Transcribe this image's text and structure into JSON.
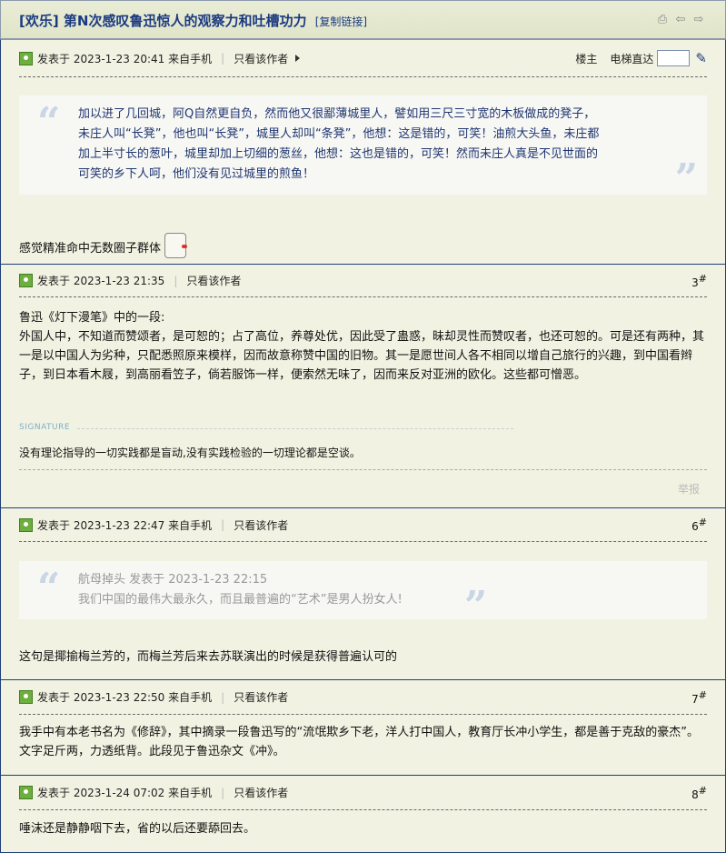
{
  "header": {
    "title": "[欢乐] 第N次感叹鲁迅惊人的观察力和吐槽功力",
    "copy_link": "[复制链接]",
    "icons": [
      "print-icon",
      "prev-icon",
      "next-icon"
    ]
  },
  "posts": [
    {
      "meta": "发表于 2023-1-23 20:41 来自手机",
      "only_author": "只看该作者",
      "floor_label": "楼主",
      "jump_label": "电梯直达",
      "quote": {
        "lines": [
          "加以进了几回城，阿Q自然更自负，然而他又很鄙薄城里人，譬如用三尺三寸宽的木板做成的凳子，",
          "未庄人叫“长凳”，他也叫“长凳”，城里人却叫“条凳”，他想：这是错的，可笑！油煎大头鱼，未庄都",
          "加上半寸长的葱叶，城里却加上切细的葱丝，他想：这也是错的，可笑！然而未庄人真是不见世面的",
          "可笑的乡下人呵，他们没有见过城里的煎鱼！"
        ]
      },
      "body": "感觉精准命中无数圈子群体"
    },
    {
      "meta": "发表于 2023-1-23 21:35",
      "only_author": "只看该作者",
      "floor": "3",
      "body_lines": [
        "鲁迅《灯下漫笔》中的一段:",
        "外国人中，不知道而赞颂者，是可恕的；占了高位，养尊处优，因此受了蛊惑，昧却灵性而赞叹者，也还可恕的。可是还有两种，其一是以中国人为劣种，只配悉照原来模样，因而故意称赞中国的旧物。其一是愿世间人各不相同以增自己旅行的兴趣，到中国看辫子，到日本看木屐，到高丽看笠子，倘若服饰一样，便索然无味了，因而来反对亚洲的欧化。这些都可憎恶。"
      ],
      "signature_label": "SIGNATURE",
      "signature": "没有理论指导的一切实践都是盲动,没有实践检验的一切理论都是空谈。",
      "report": "举报"
    },
    {
      "meta": "发表于 2023-1-23 22:47 来自手机",
      "only_author": "只看该作者",
      "floor": "6",
      "quote_author": "航母掉头 发表于 2023-1-23 22:15",
      "quote_text": "我们中国的最伟大最永久，而且最普遍的“艺术”是男人扮女人!",
      "body": "这句是揶揄梅兰芳的，而梅兰芳后来去苏联演出的时候是获得普遍认可的"
    },
    {
      "meta": "发表于 2023-1-23 22:50 来自手机",
      "only_author": "只看该作者",
      "floor": "7",
      "body": "我手中有本老书名为《修辞》，其中摘录一段鲁迅写的“流氓欺乡下老，洋人打中国人，教育厅长冲小学生，都是善于克敌的豪杰”。文字足斤两，力透纸背。此段见于鲁迅杂文《冲》。"
    },
    {
      "meta": "发表于 2023-1-24 07:02 来自手机",
      "only_author": "只看该作者",
      "floor": "8",
      "body": "唾沫还是静静咽下去，省的以后还要舔回去。"
    }
  ],
  "floor_suffix": "#"
}
